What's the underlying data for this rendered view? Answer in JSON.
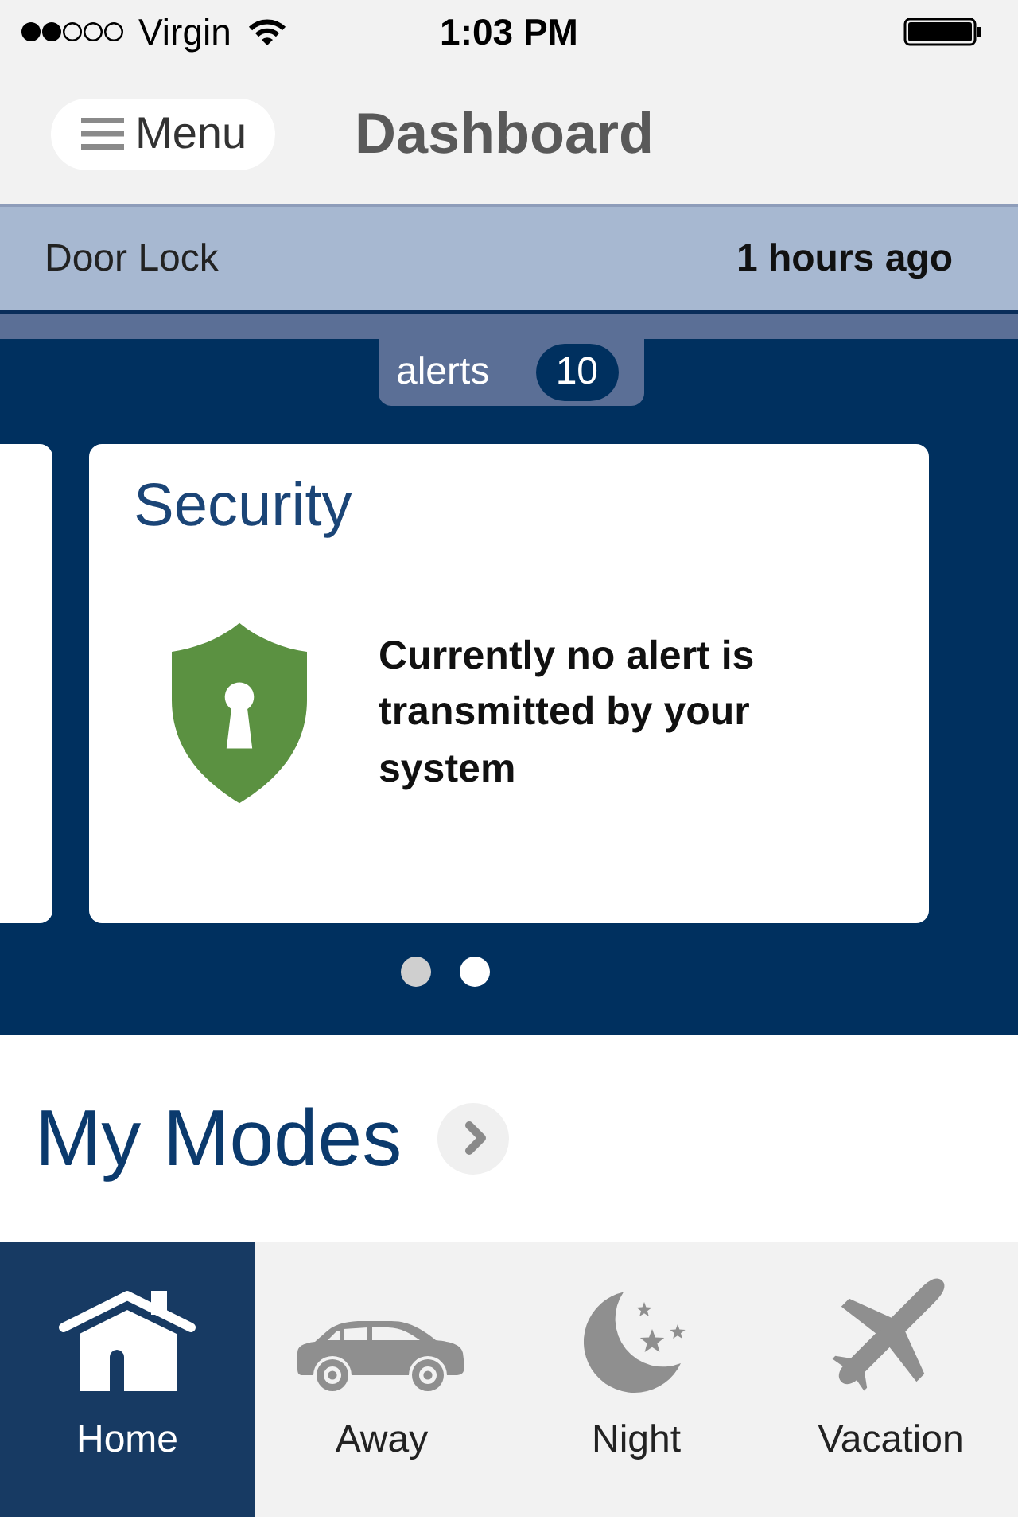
{
  "status_bar": {
    "carrier": "Virgin",
    "time": "1:03 PM"
  },
  "header": {
    "menu_label": "Menu",
    "title": "Dashboard"
  },
  "notification": {
    "device": "Door Lock",
    "time": "1 hours ago"
  },
  "alerts": {
    "label": "alerts",
    "count": "10"
  },
  "carousel": {
    "cards": [
      {
        "title": "Security",
        "message": "Currently no alert is transmitted by your system"
      }
    ],
    "pages": [
      {
        "selected": false
      },
      {
        "selected": true
      }
    ]
  },
  "modes": {
    "title": "My Modes",
    "items": [
      {
        "kind": "home",
        "label": "Home",
        "selected": true
      },
      {
        "kind": "car",
        "label": "Away",
        "selected": false
      },
      {
        "kind": "moon",
        "label": "Night",
        "selected": false
      },
      {
        "kind": "plane",
        "label": "Vacation",
        "selected": false
      }
    ]
  }
}
